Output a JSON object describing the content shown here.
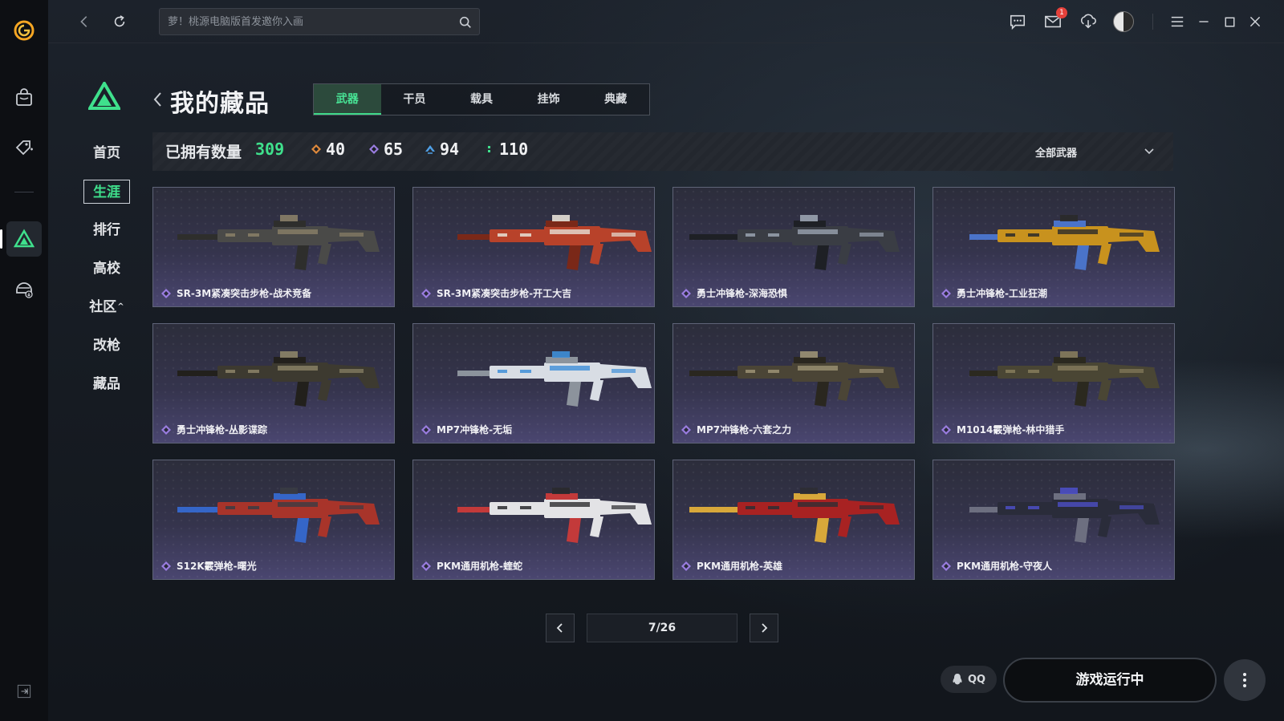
{
  "colors": {
    "accent_green": "#3fe08c",
    "rarity_purple": "#9a7de0",
    "rarity_orange": "#e08a3c",
    "rarity_blue": "#4f9fe5",
    "badge_red": "#e5413b"
  },
  "rail": {
    "icons": [
      "client-logo-icon",
      "bag-icon",
      "tag-icon",
      "game-triangle-icon",
      "helmet-download-icon",
      "collapse-icon"
    ]
  },
  "topbar": {
    "search_placeholder": "萝！桃源电脑版首发邀你入画",
    "mail_badge": "1",
    "icons": [
      "back-icon",
      "refresh-icon",
      "search-icon",
      "chat-icon",
      "mail-icon",
      "download-icon",
      "avatar",
      "menu-icon",
      "minimize-icon",
      "maximize-icon",
      "close-icon"
    ]
  },
  "side_nav": {
    "items": [
      "首页",
      "生涯",
      "排行",
      "高校",
      "社区",
      "改枪",
      "藏品"
    ],
    "active": "生涯",
    "community_caret": "^"
  },
  "page": {
    "title": "我的藏品",
    "tabs": [
      "武器",
      "干员",
      "载具",
      "挂饰",
      "典藏"
    ],
    "active_tab": "武器"
  },
  "summary": {
    "own_label": "已拥有数量",
    "own_count": "309",
    "rarity_counts": [
      {
        "rarity": "orange",
        "count": "40"
      },
      {
        "rarity": "purple",
        "count": "65"
      },
      {
        "rarity": "blue",
        "count": "94"
      },
      {
        "rarity": "green",
        "count": "110"
      }
    ],
    "filter_value": "全部武器"
  },
  "cards": [
    {
      "name": "SR-3M紧凑突击步枪-战术竞备",
      "rarity": "purple",
      "palette": [
        "#4a4a48",
        "#8a8068",
        "#2e2e2c"
      ]
    },
    {
      "name": "SR-3M紧凑突击步枪-开工大吉",
      "rarity": "purple",
      "palette": [
        "#b8422a",
        "#e6e0d6",
        "#7a2818"
      ]
    },
    {
      "name": "勇士冲锋枪-深海恐惧",
      "rarity": "purple",
      "palette": [
        "#3a3d44",
        "#9aa3b0",
        "#1e2025"
      ]
    },
    {
      "name": "勇士冲锋枪-工业狂潮",
      "rarity": "purple",
      "palette": [
        "#c8921e",
        "#2a2a2a",
        "#4a73c9"
      ]
    },
    {
      "name": "勇士冲锋枪-丛影谍踪",
      "rarity": "purple",
      "palette": [
        "#3d3a30",
        "#8c8468",
        "#22201c"
      ]
    },
    {
      "name": "MP7冲锋枪-无垢",
      "rarity": "purple",
      "palette": [
        "#d8dde4",
        "#3f8fd8",
        "#8c939c"
      ]
    },
    {
      "name": "MP7冲锋枪-六套之力",
      "rarity": "purple",
      "palette": [
        "#4b4536",
        "#9c9274",
        "#2a271f"
      ]
    },
    {
      "name": "M1014霰弹枪-林中猎手",
      "rarity": "purple",
      "palette": [
        "#4a4634",
        "#867c5c",
        "#2b291f"
      ]
    },
    {
      "name": "S12K霰弹枪-曙光",
      "rarity": "purple",
      "palette": [
        "#a8342a",
        "#3a3c44",
        "#3566c8"
      ]
    },
    {
      "name": "PKM通用机枪-蝰蛇",
      "rarity": "purple",
      "palette": [
        "#e3e3e6",
        "#2a2a2e",
        "#c33a3a"
      ]
    },
    {
      "name": "PKM通用机枪-英雄",
      "rarity": "purple",
      "palette": [
        "#a82222",
        "#2e2e34",
        "#d8a83a"
      ]
    },
    {
      "name": "PKM通用机枪-守夜人",
      "rarity": "purple",
      "palette": [
        "#2a2c3a",
        "#4c4fc4",
        "#6d6f80"
      ]
    }
  ],
  "pagination": {
    "display": "7/26"
  },
  "bottom": {
    "qq_label": "QQ",
    "game_status": "游戏运行中"
  }
}
